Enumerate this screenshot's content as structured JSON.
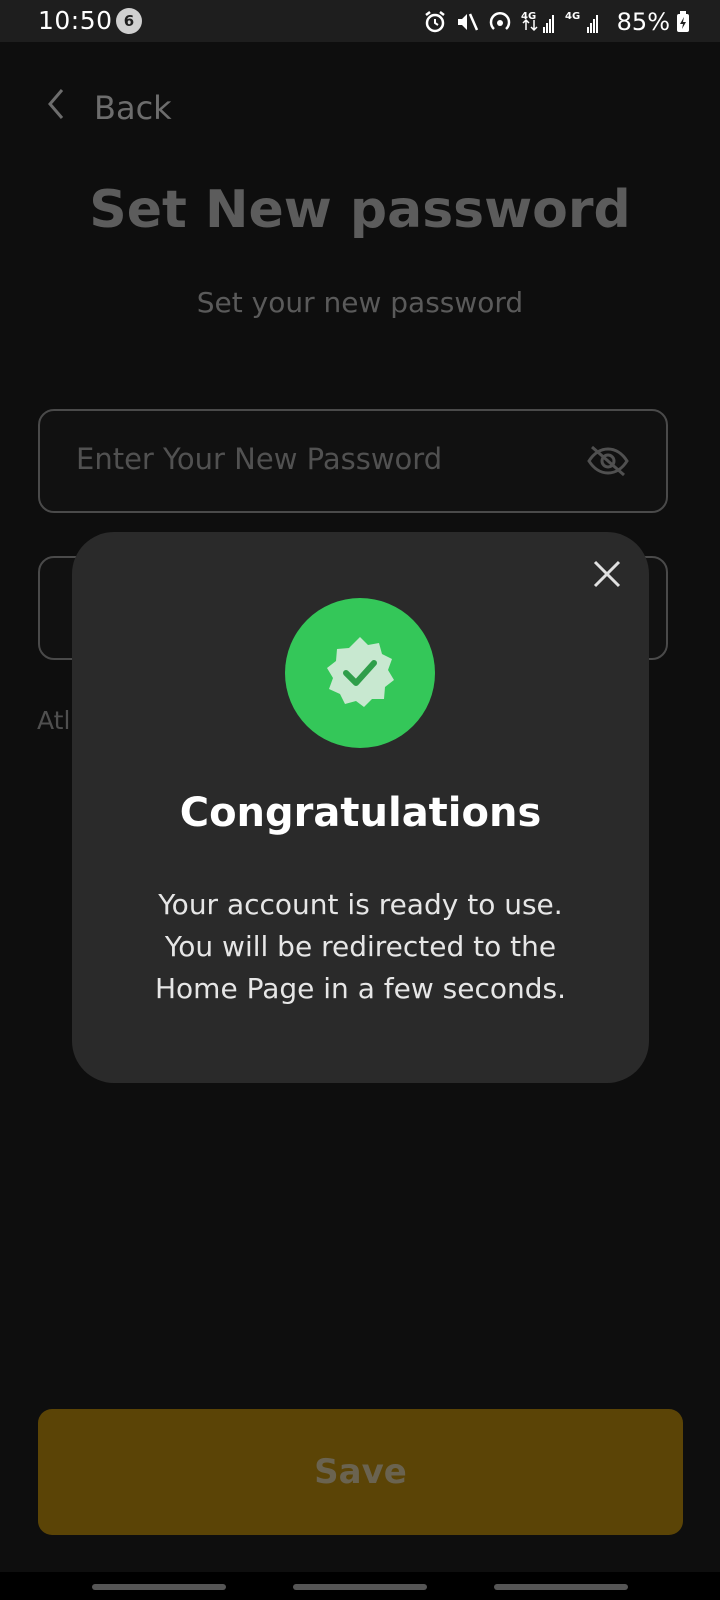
{
  "status_bar": {
    "time": "10:50",
    "notification_count": "6",
    "battery": "85%",
    "network_1": "4G",
    "network_2": "4G"
  },
  "header": {
    "back_label": "Back"
  },
  "page": {
    "title": "Set New password",
    "subtitle": "Set your new password",
    "password_placeholder": "Enter Your New Password",
    "hint_partial": "Atl",
    "save_label": "Save"
  },
  "modal": {
    "title": "Congratulations",
    "message_lines": [
      "Your account is ready to use.",
      "You will be redirected to the",
      "Home Page in a few seconds."
    ]
  },
  "colors": {
    "success": "#34c759",
    "save_button": "#5b4406",
    "modal_bg": "#2a2a2a"
  }
}
